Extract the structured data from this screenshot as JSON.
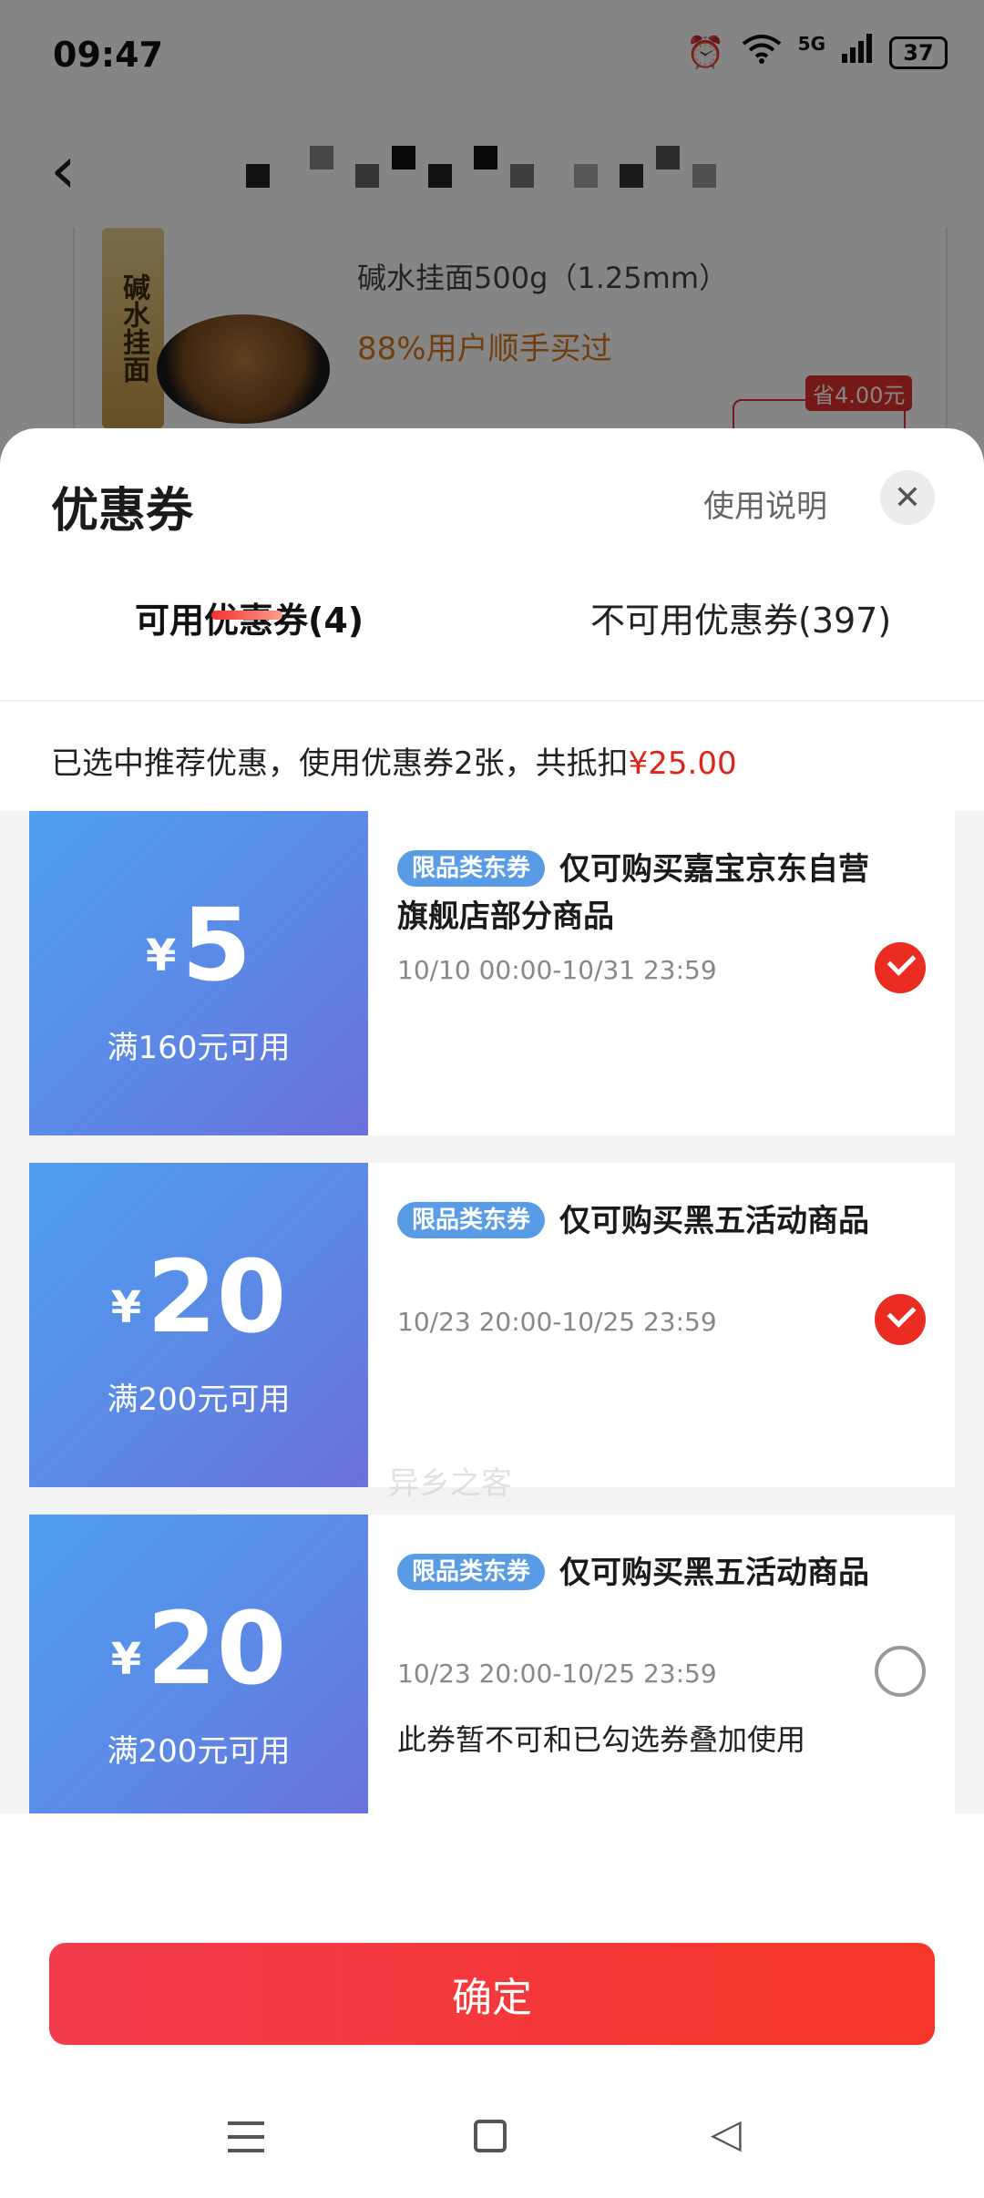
{
  "status_bar": {
    "time": "09:47",
    "network": "5G",
    "battery": "37"
  },
  "background": {
    "product_line1": "碱水挂面500g（1.25mm）",
    "product_line2": "88%用户顺手买过",
    "save_badge": "省4.00元",
    "package_label": "碱水挂面"
  },
  "sheet": {
    "title": "优惠券",
    "help": "使用说明",
    "tabs": [
      {
        "label": "可用优惠券(4)",
        "active": true
      },
      {
        "label": "不可用优惠券(397)",
        "active": false
      }
    ],
    "summary_prefix": "已选中推荐优惠，使用优惠券2张，共抵扣",
    "summary_amount": "¥25.00",
    "watermark": "异乡之客"
  },
  "coupons": [
    {
      "currency": "¥",
      "amount": "5",
      "condition": "满160元可用",
      "tag": "限品类东券",
      "title": "仅可购买嘉宝京东自营旗舰店部分商品",
      "validity": "10/10 00:00-10/31 23:59",
      "note": "",
      "selected": true
    },
    {
      "currency": "¥",
      "amount": "20",
      "condition": "满200元可用",
      "tag": "限品类东券",
      "title": "仅可购买黑五活动商品",
      "validity": "10/23 20:00-10/25 23:59",
      "note": "",
      "selected": true
    },
    {
      "currency": "¥",
      "amount": "20",
      "condition": "满200元可用",
      "tag": "限品类东券",
      "title": "仅可购买黑五活动商品",
      "validity": "10/23 20:00-10/25 23:59",
      "note": "此券暂不可和已勾选券叠加使用",
      "selected": false
    }
  ],
  "footer": {
    "confirm": "确定"
  },
  "colors": {
    "accent": "#e2231a",
    "coupon_blue": "#5b8be6",
    "tag_blue": "#5a9be6"
  }
}
